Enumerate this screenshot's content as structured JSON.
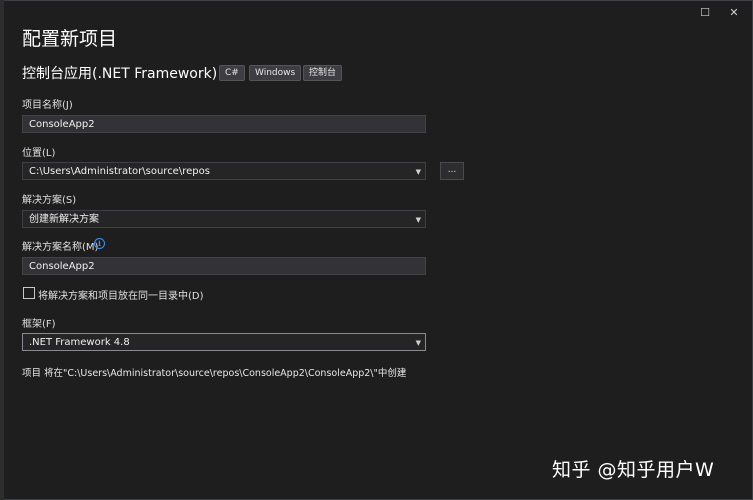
{
  "header": {
    "title": "配置新项目",
    "template_name": "控制台应用(.NET Framework)",
    "tags": [
      "C#",
      "Windows",
      "控制台"
    ]
  },
  "form": {
    "project_name_label": "项目名称(J)",
    "project_name_value": "ConsoleApp2",
    "location_label": "位置(L)",
    "location_value": "C:\\Users\\Administrator\\source\\repos",
    "browse_label": "...",
    "solution_label": "解决方案(S)",
    "solution_value": "创建新解决方案",
    "solution_name_label": "解决方案名称(M)",
    "solution_name_value": "ConsoleApp2",
    "same_dir_checkbox_label": "将解决方案和项目放在同一目录中(D)",
    "same_dir_checked": false,
    "framework_label": "框架(F)",
    "framework_value": ".NET Framework 4.8",
    "summary": "项目 将在\"C:\\Users\\Administrator\\source\\repos\\ConsoleApp2\\ConsoleApp2\\\"中创建"
  },
  "window": {
    "restore_glyph": "☐",
    "close_glyph": "✕"
  },
  "watermark": "知乎 @知乎用户W",
  "colors": {
    "background": "#1e1e1e",
    "field": "#333337",
    "accent": "#3794ff"
  }
}
